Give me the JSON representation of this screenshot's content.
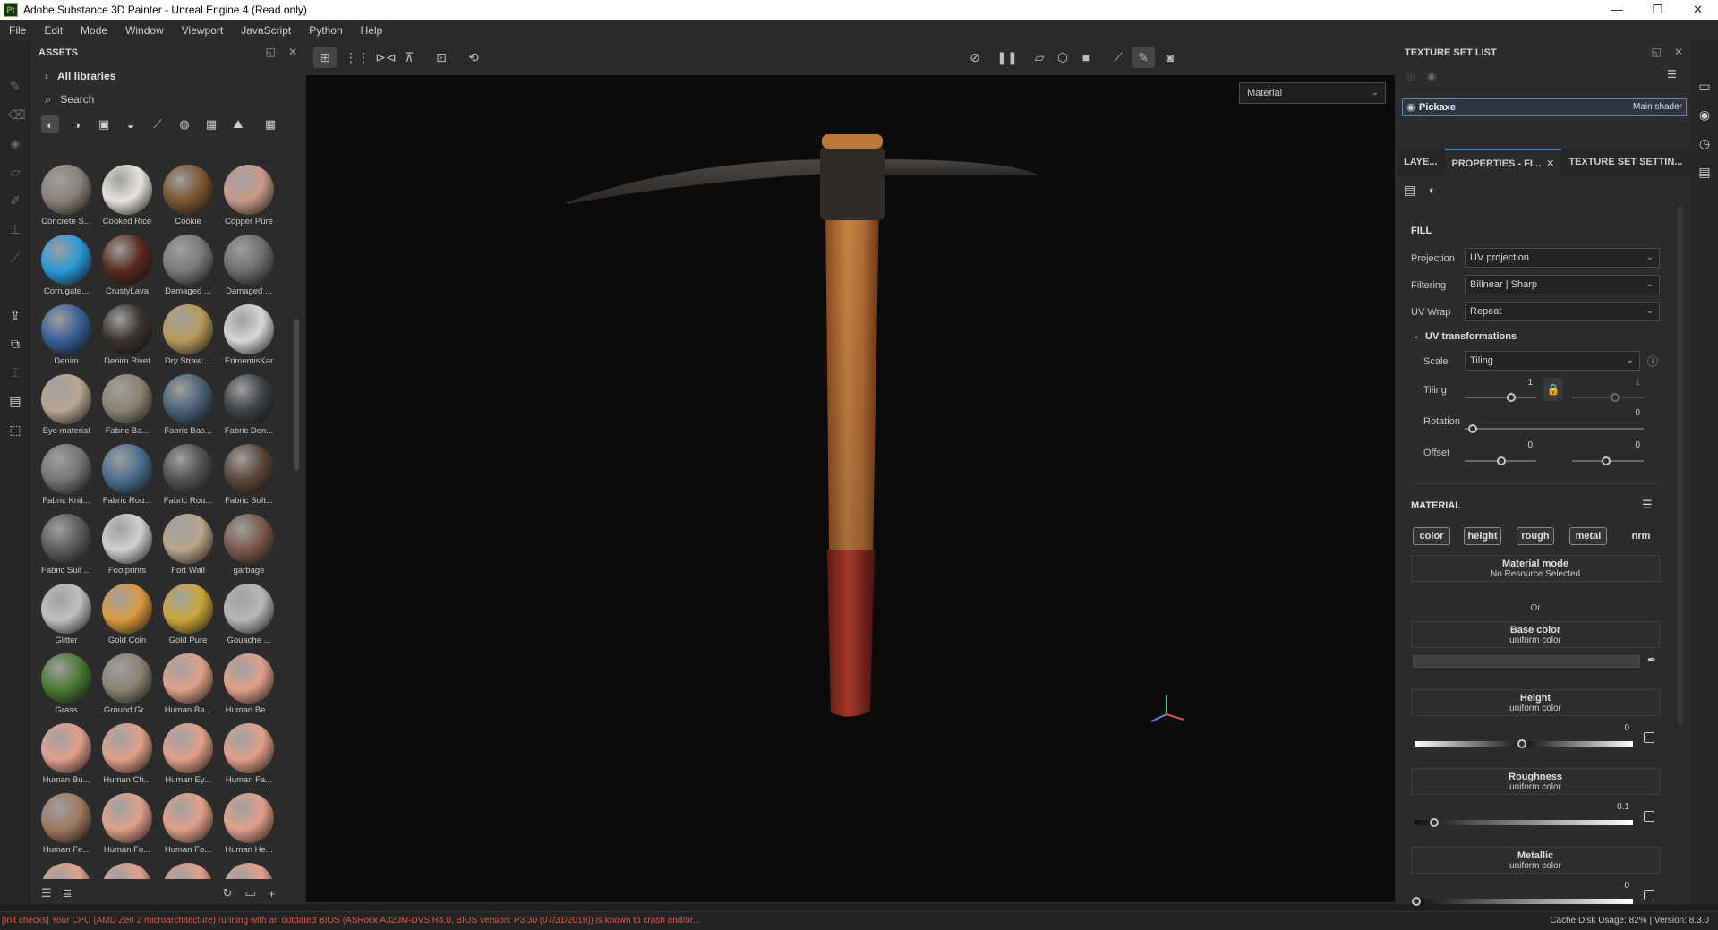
{
  "window": {
    "app_icon": "Pt",
    "title": "Adobe Substance 3D Painter - Unreal Engine 4 (Read only)",
    "controls": [
      "—",
      "❐",
      "✕"
    ]
  },
  "menu": [
    "File",
    "Edit",
    "Mode",
    "Window",
    "Viewport",
    "JavaScript",
    "Python",
    "Help"
  ],
  "assets": {
    "header": "ASSETS",
    "library": "All libraries",
    "search_placeholder": "Search",
    "items": [
      {
        "label": "Concrete S...",
        "color": "#8a8278"
      },
      {
        "label": "Cooked Rice",
        "color": "#e6e3dc"
      },
      {
        "label": "Cookie",
        "color": "#7a5530"
      },
      {
        "label": "Copper Pure",
        "color": "#c99a88"
      },
      {
        "label": "Corrugate...",
        "color": "#2b9ad6"
      },
      {
        "label": "CrustyLava",
        "color": "#5a2a1e"
      },
      {
        "label": "Damaged ...",
        "color": "#7a7a7a"
      },
      {
        "label": "Damaged ...",
        "color": "#6e6e6e"
      },
      {
        "label": "Denim",
        "color": "#3a5f96"
      },
      {
        "label": "Denim Rivet",
        "color": "#3a3330"
      },
      {
        "label": "Dry Straw ...",
        "color": "#b89a5c"
      },
      {
        "label": "ErimemisKar",
        "color": "#d6d6d6"
      },
      {
        "label": "Eye material",
        "color": "#b8a690"
      },
      {
        "label": "Fabric Ba...",
        "color": "#8a8472"
      },
      {
        "label": "Fabric Bas...",
        "color": "#4a6278"
      },
      {
        "label": "Fabric Den...",
        "color": "#3e4246"
      },
      {
        "label": "Fabric Knit...",
        "color": "#767676"
      },
      {
        "label": "Fabric Rou...",
        "color": "#4c6e8e"
      },
      {
        "label": "Fabric Rou...",
        "color": "#505050"
      },
      {
        "label": "Fabric Soft...",
        "color": "#5a4638"
      },
      {
        "label": "Fabric Suit ...",
        "color": "#5c5c5c"
      },
      {
        "label": "Footprints",
        "color": "#d0d0d0"
      },
      {
        "label": "Fort Wall",
        "color": "#b8a48a"
      },
      {
        "label": "garbage",
        "color": "#7a5a4a"
      },
      {
        "label": "Glitter",
        "color": "#c0c0c0"
      },
      {
        "label": "Gold Coin",
        "color": "#d89a40"
      },
      {
        "label": "Gold Pure",
        "color": "#c9a63a"
      },
      {
        "label": "Gouache ...",
        "color": "#b8b8b8"
      },
      {
        "label": "Grass",
        "color": "#4a7a32"
      },
      {
        "label": "Ground Gr...",
        "color": "#8a8474"
      },
      {
        "label": "Human Ba...",
        "color": "#e0a08a"
      },
      {
        "label": "Human Be...",
        "color": "#e0a08a"
      },
      {
        "label": "Human Bu...",
        "color": "#e0a08a"
      },
      {
        "label": "Human Ch...",
        "color": "#e0a08a"
      },
      {
        "label": "Human Ey...",
        "color": "#e0a08a"
      },
      {
        "label": "Human Fa...",
        "color": "#e0a08a"
      },
      {
        "label": "Human Fe...",
        "color": "#a07a60"
      },
      {
        "label": "Human Fo...",
        "color": "#e0a08a"
      },
      {
        "label": "Human Fo...",
        "color": "#e0a08a"
      },
      {
        "label": "Human He...",
        "color": "#e0a08a"
      },
      {
        "label": "",
        "color": "#e0a08a"
      },
      {
        "label": "",
        "color": "#e0a08a"
      },
      {
        "label": "",
        "color": "#e0a08a"
      },
      {
        "label": "",
        "color": "#e0a08a"
      }
    ]
  },
  "viewport": {
    "material_dropdown": "Material"
  },
  "texture_set_list": {
    "header": "TEXTURE SET LIST",
    "row_name": "Pickaxe",
    "row_shader": "Main shader"
  },
  "properties": {
    "tabs": [
      "LAYE...",
      "PROPERTIES - FI...",
      "TEXTURE SET SETTIN..."
    ],
    "fill": {
      "title": "FILL",
      "projection_label": "Projection",
      "projection_value": "UV projection",
      "filtering_label": "Filtering",
      "filtering_value": "Bilinear | Sharp",
      "uvwrap_label": "UV Wrap",
      "uvwrap_value": "Repeat",
      "uvtrans_title": "UV transformations",
      "scale_label": "Scale",
      "scale_value": "Tiling",
      "tiling_label": "Tiling",
      "tiling_value": "1",
      "tiling_value2": "1",
      "rotation_label": "Rotation",
      "rotation_value": "0",
      "offset_label": "Offset",
      "offset_value1": "0",
      "offset_value2": "0"
    },
    "material": {
      "title": "MATERIAL",
      "channels": [
        "color",
        "height",
        "rough",
        "metal",
        "nrm"
      ],
      "mode_title": "Material mode",
      "mode_sub": "No Resource Selected",
      "or": "Or",
      "base_title": "Base color",
      "base_sub": "uniform color",
      "height_title": "Height",
      "height_sub": "uniform color",
      "height_value": "0",
      "rough_title": "Roughness",
      "rough_sub": "uniform color",
      "rough_value": "0.1",
      "metal_title": "Metallic",
      "metal_sub": "uniform color",
      "metal_value": "0"
    }
  },
  "status": {
    "error": "[Init checks] Your CPU (AMD Zen 2 microarchitecture) running with an outdated BIOS (ASRock A320M-DVS R4.0, BIOS version: P3.30 (07/31/2019)) is known to crash and/or...",
    "right": "Cache Disk Usage:   82% | Version: 8.3.0"
  }
}
